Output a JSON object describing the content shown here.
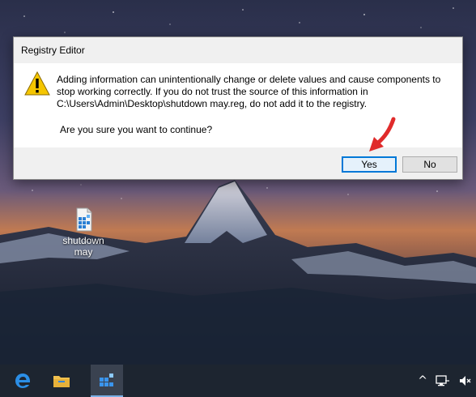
{
  "dialog": {
    "title": "Registry Editor",
    "message_line1": "Adding information can unintentionally change or delete values and cause components to",
    "message_line2": "stop working correctly. If you do not trust the source of this information in",
    "message_line3": "C:\\Users\\Admin\\Desktop\\shutdown may.reg, do not add it to the registry.",
    "question": "Are you sure you want to continue?",
    "yes_label": "Yes",
    "no_label": "No",
    "icon": "warning-icon"
  },
  "desktop": {
    "icon_label_line1": "shutdown",
    "icon_label_line2": "may"
  },
  "taskbar": {
    "items": [
      "edge-icon",
      "file-explorer-icon",
      "registry-editor-icon"
    ],
    "tray": [
      "chevron-up-icon",
      "network-icon",
      "volume-muted-icon"
    ]
  },
  "colors": {
    "accent": "#0078d7",
    "arrow": "#e02b2b",
    "taskbar": "#1d2530"
  }
}
